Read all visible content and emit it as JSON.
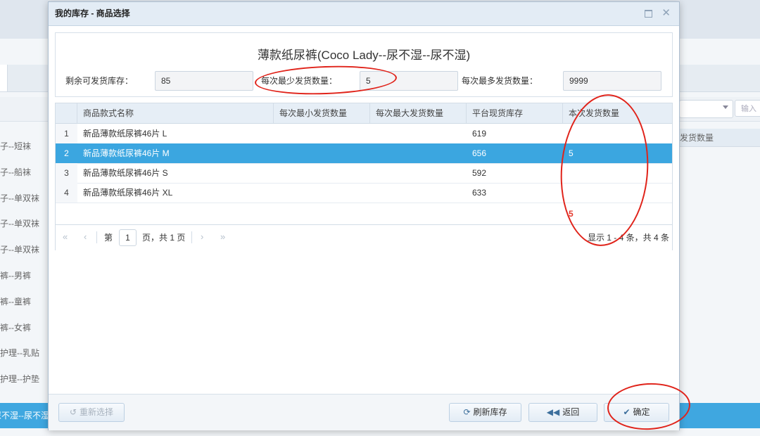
{
  "dialog": {
    "title": "我的库存 - 商品选择",
    "maximize_symbol": "□",
    "close_symbol": "✕"
  },
  "product": {
    "name": "薄款纸尿裤(Coco Lady--尿不湿--尿不湿)",
    "remaining_label": "剩余可发货库存：",
    "remaining_value": "85",
    "min_label": "每次最少发货数量：",
    "min_value": "5",
    "max_label": "每次最多发货数量：",
    "max_value": "9999"
  },
  "grid": {
    "headers": [
      "商品款式名称",
      "每次最小发货数量",
      "每次最大发货数量",
      "平台现货库存",
      "本次发货数量"
    ],
    "rows": [
      {
        "no": "1",
        "name": "新品薄款纸尿裤46片 L",
        "min": "",
        "max": "",
        "stock": "619",
        "qty": "",
        "selected": false
      },
      {
        "no": "2",
        "name": "新品薄款纸尿裤46片 M",
        "min": "",
        "max": "",
        "stock": "656",
        "qty": "5",
        "selected": true
      },
      {
        "no": "3",
        "name": "新品薄款纸尿裤46片 S",
        "min": "",
        "max": "",
        "stock": "592",
        "qty": "",
        "selected": false
      },
      {
        "no": "4",
        "name": "新品薄款纸尿裤46片 XL",
        "min": "",
        "max": "",
        "stock": "633",
        "qty": "",
        "selected": false
      }
    ],
    "total_qty": "5"
  },
  "pager": {
    "page_prefix": "第",
    "page_value": "1",
    "page_suffix": "页，共 1 页",
    "info": "显示 1 - 4 条，共 4 条",
    "icons": [
      "first-page-icon",
      "prev-page-icon",
      "next-page-icon",
      "last-page-icon"
    ]
  },
  "footer": {
    "reselect_label": "重新选择",
    "refresh_label": "刷新库存",
    "back_label": "返回",
    "confirm_label": "确定"
  },
  "background": {
    "list_items": [
      "袜子--短袜",
      "袜子--船袜",
      "袜子--单双袜",
      "袜子--单双袜",
      "袜子--单双袜",
      "内裤--男裤",
      "内裤--童裤",
      "内裤--女裤",
      "私密护理--乳贴",
      "私密护理--护垫"
    ],
    "selected_item": "尿不湿--尿不湿",
    "right_header": "发货数量",
    "right_input_placeholder": "输入"
  },
  "colors": {
    "selection": "#3ba6e0",
    "annotation": "#e0231a",
    "header_bg": "#e3ecf5"
  }
}
